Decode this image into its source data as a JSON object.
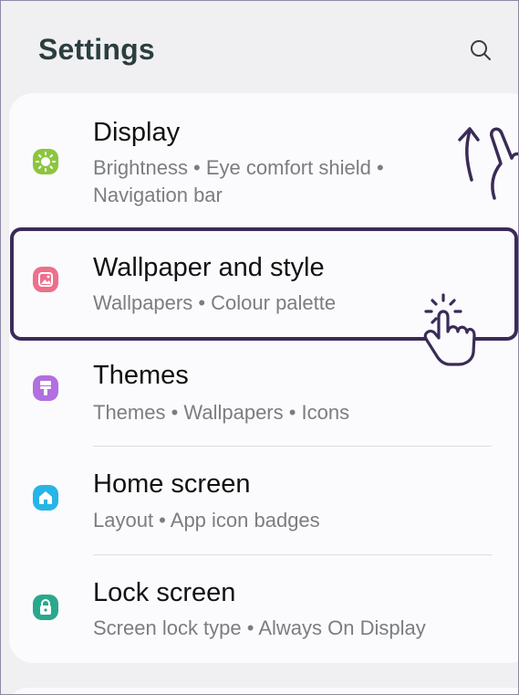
{
  "header": {
    "title": "Settings",
    "search_icon": "search-icon"
  },
  "items": [
    {
      "title": "Display",
      "subtitle_line1": "Brightness  •  Eye comfort shield  •",
      "subtitle_line2": "Navigation bar",
      "icon": "sun-icon",
      "icon_color": "#8cc63f"
    },
    {
      "title": "Wallpaper and style",
      "subtitle_line1": "Wallpapers  •  Colour palette",
      "icon": "image-icon",
      "icon_color": "#ee6f8c"
    },
    {
      "title": "Themes",
      "subtitle_line1": "Themes  •  Wallpapers  •  Icons",
      "icon": "paint-brush-icon",
      "icon_color": "#b16fdf"
    },
    {
      "title": "Home screen",
      "subtitle_line1": "Layout  •  App icon badges",
      "icon": "home-icon",
      "icon_color": "#26b5e6"
    },
    {
      "title": "Lock screen",
      "subtitle_line1": "Screen lock type  •  Always On Display",
      "icon": "lock-icon",
      "icon_color": "#2aa88c"
    }
  ],
  "colors": {
    "highlight_border": "#3a2b57",
    "background": "#f0f0f2",
    "card": "#fbfbfd"
  }
}
